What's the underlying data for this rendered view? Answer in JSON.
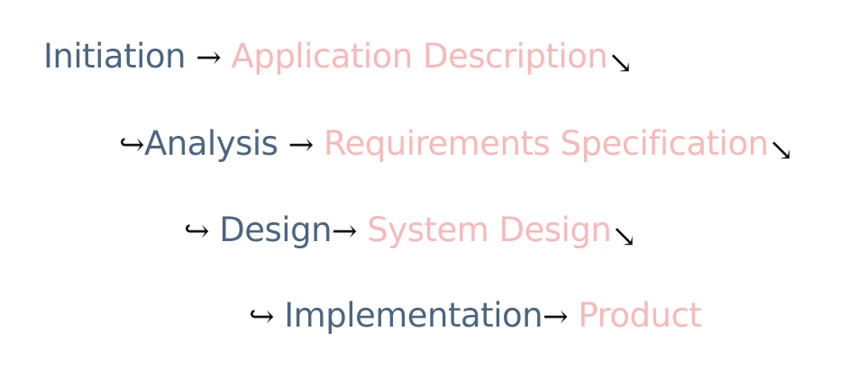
{
  "flow": {
    "rows": [
      {
        "lead": "",
        "phase": "Initiation",
        "arrow": "→",
        "artifact": "Application Description",
        "trail": "↘"
      },
      {
        "lead": "↪",
        "phase": "Analysis",
        "arrow": "→",
        "artifact": "Requirements Specification",
        "trail": "↘"
      },
      {
        "lead": "↪",
        "phase": "Design",
        "arrow": "→",
        "artifact": "System Design",
        "trail": "↘"
      },
      {
        "lead": "↪",
        "phase": "Implementation",
        "arrow": "→",
        "artifact": "Product",
        "trail": ""
      }
    ]
  },
  "colors": {
    "phase": "#4c6580",
    "artifact": "#f7b9b9",
    "arrow": "#111111"
  }
}
